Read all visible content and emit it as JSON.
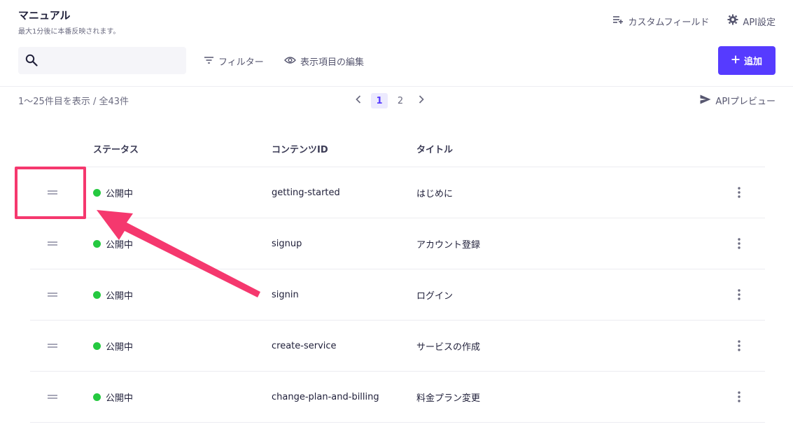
{
  "header": {
    "title": "マニュアル",
    "subtitle": "最大1分後に本番反映されます。",
    "custom_field_label": "カスタムフィールド",
    "api_settings_label": "API設定"
  },
  "toolbar": {
    "search_placeholder": "",
    "filter_label": "フィルター",
    "display_edit_label": "表示項目の編集",
    "add_label": "追加"
  },
  "listing": {
    "count_text": "1〜25件目を表示 / 全43件",
    "pages": [
      "1",
      "2"
    ],
    "current_page": "1",
    "api_preview_label": "APIプレビュー"
  },
  "table": {
    "columns": {
      "status": "ステータス",
      "content_id": "コンテンツID",
      "title": "タイトル"
    },
    "rows": [
      {
        "status": "公開中",
        "content_id": "getting-started",
        "title": "はじめに"
      },
      {
        "status": "公開中",
        "content_id": "signup",
        "title": "アカウント登録"
      },
      {
        "status": "公開中",
        "content_id": "signin",
        "title": "ログイン"
      },
      {
        "status": "公開中",
        "content_id": "create-service",
        "title": "サービスの作成"
      },
      {
        "status": "公開中",
        "content_id": "change-plan-and-billing",
        "title": "料金プラン変更"
      }
    ]
  },
  "colors": {
    "accent": "#563bff",
    "status_published": "#25c940",
    "annotation": "#f5386e"
  },
  "icons": {
    "search": "search-icon",
    "custom_field": "playlist-add-icon",
    "api_settings": "gear-icon",
    "filter": "filter-icon",
    "display_edit": "eye-icon",
    "add": "plus-icon",
    "prev": "chevron-left-icon",
    "next": "chevron-right-icon",
    "api_preview": "send-icon",
    "row_handle": "drag-handle-icon",
    "row_menu": "kebab-menu-icon"
  }
}
